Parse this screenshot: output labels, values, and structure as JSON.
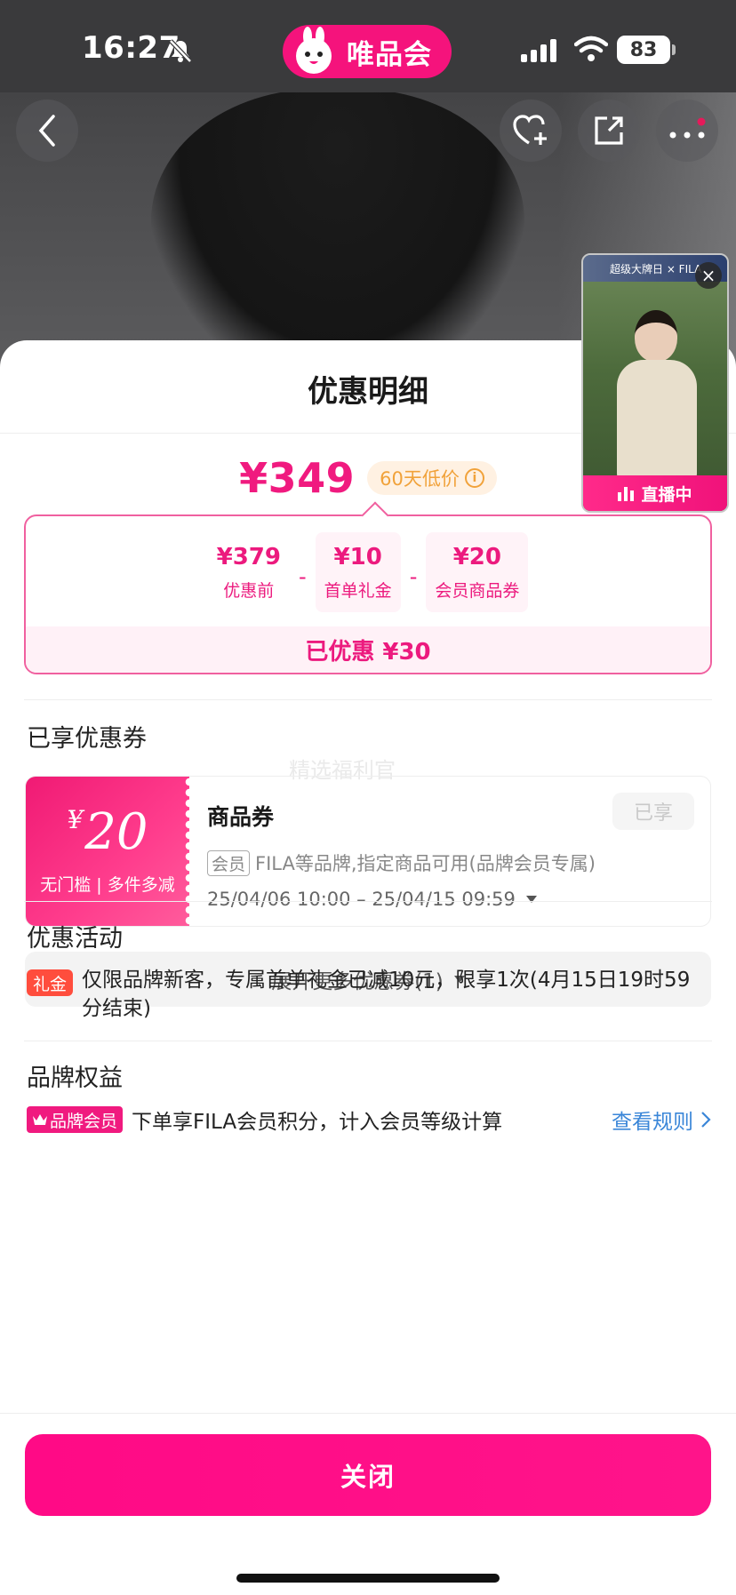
{
  "status_bar": {
    "time": "16:27",
    "brand": "唯品会",
    "battery": "83"
  },
  "live": {
    "banner": "超级大牌日 × FILA",
    "label": "直播中"
  },
  "sheet": {
    "title": "优惠明细",
    "price": "¥349",
    "low_price_badge": "60天低价",
    "breakdown": {
      "items": [
        {
          "value": "¥379",
          "label": "优惠前"
        },
        {
          "value": "¥10",
          "label": "首单礼金"
        },
        {
          "value": "¥20",
          "label": "会员商品券"
        }
      ],
      "separator": "-",
      "total": "已优惠 ¥30"
    },
    "coupons_section_title": "已享优惠券",
    "watermark": "精选福利官",
    "coupon": {
      "currency": "¥",
      "amount": "20",
      "note": "无门槛 | 多件多减",
      "name": "商品券",
      "status": "已享",
      "tag": "会员",
      "desc": "FILA等品牌,指定商品可用(品牌会员专属)",
      "date": "25/04/06 10:00 – 25/04/15 09:59"
    },
    "expand_label": "展开更多优惠券(1)",
    "activity_section_title": "优惠活动",
    "activity": {
      "tag": "礼金",
      "text": "仅限品牌新客，专属首单礼金已减10元，限享1次(4月15日19时59分结束)"
    },
    "brand_section_title": "品牌权益",
    "brand_benefit": {
      "tag": "品牌会员",
      "text": "下单享FILA会员积分，计入会员等级计算",
      "link": "查看规则"
    },
    "close_label": "关闭"
  },
  "colors": {
    "accent": "#f01a7f",
    "link": "#3a86d8",
    "badge_orange": "#f1a23a",
    "gift_red": "#ff4d3d"
  }
}
